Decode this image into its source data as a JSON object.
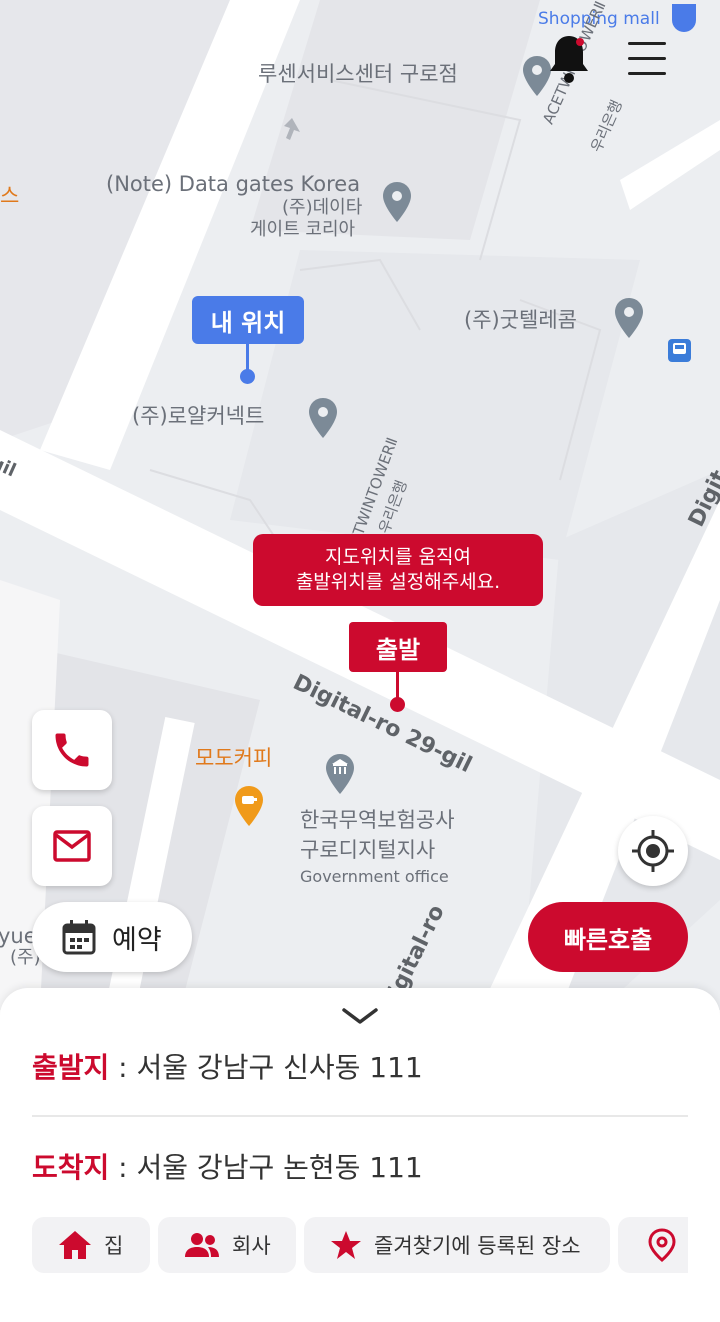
{
  "map": {
    "top_label": "Shopping mall",
    "pois": {
      "lusen": "루센서비스센터 구로점",
      "datagates_en": "(Note) Data gates Korea",
      "datagates_ko1": "(주)데이타",
      "datagates_ko2": "게이트 코리아",
      "goodtel": "(주)굿텔레콤",
      "royal": "(주)로얄커넥트",
      "modo": "모도커피",
      "kortrade1": "한국무역보험공사",
      "kortrade2": "구로디지털지사",
      "gov": "Government office",
      "left_edge": "스",
      "left_edge2": "yue",
      "left_edge3": "(주)",
      "ace1": "ACETWINTOWERⅡ",
      "ace1b": "우리은행",
      "ace2": "ACETWINTOWERⅡ",
      "ace2b": "우리은행"
    },
    "roads": {
      "digital29": "Digital-ro 29-gil",
      "digitalro": "igital-ro",
      "digital_right": "Digit",
      "left_gil": "gil"
    },
    "my_location": "내 위치",
    "hint_line1": "지도위치를 움직여",
    "hint_line2": "출발위치를 설정해주세요.",
    "start_tag": "출발"
  },
  "icons": {
    "bell": "bell-icon",
    "menu": "hamburger-menu-icon",
    "phone": "phone-icon",
    "mail": "mail-icon",
    "calendar": "calendar-icon",
    "locate": "crosshair-icon",
    "chevron": "chevron-down-icon",
    "home": "home-icon",
    "company": "people-icon",
    "favorite": "star-icon",
    "pin": "location-pin-icon"
  },
  "buttons": {
    "reserve": "예약",
    "quick_call": "빠른호출"
  },
  "sheet": {
    "origin_label": "출발지",
    "origin_sep": " : ",
    "origin_value": "서울 강남구 신사동 111",
    "dest_label": "도착지",
    "dest_sep": " : ",
    "dest_value": "서울 강남구 논현동 111",
    "chips": [
      "집",
      "회사",
      "즐겨찾기에 등록된 장소"
    ]
  },
  "colors": {
    "brand_red": "#cc0a2e",
    "my_location_blue": "#4a7be8"
  }
}
